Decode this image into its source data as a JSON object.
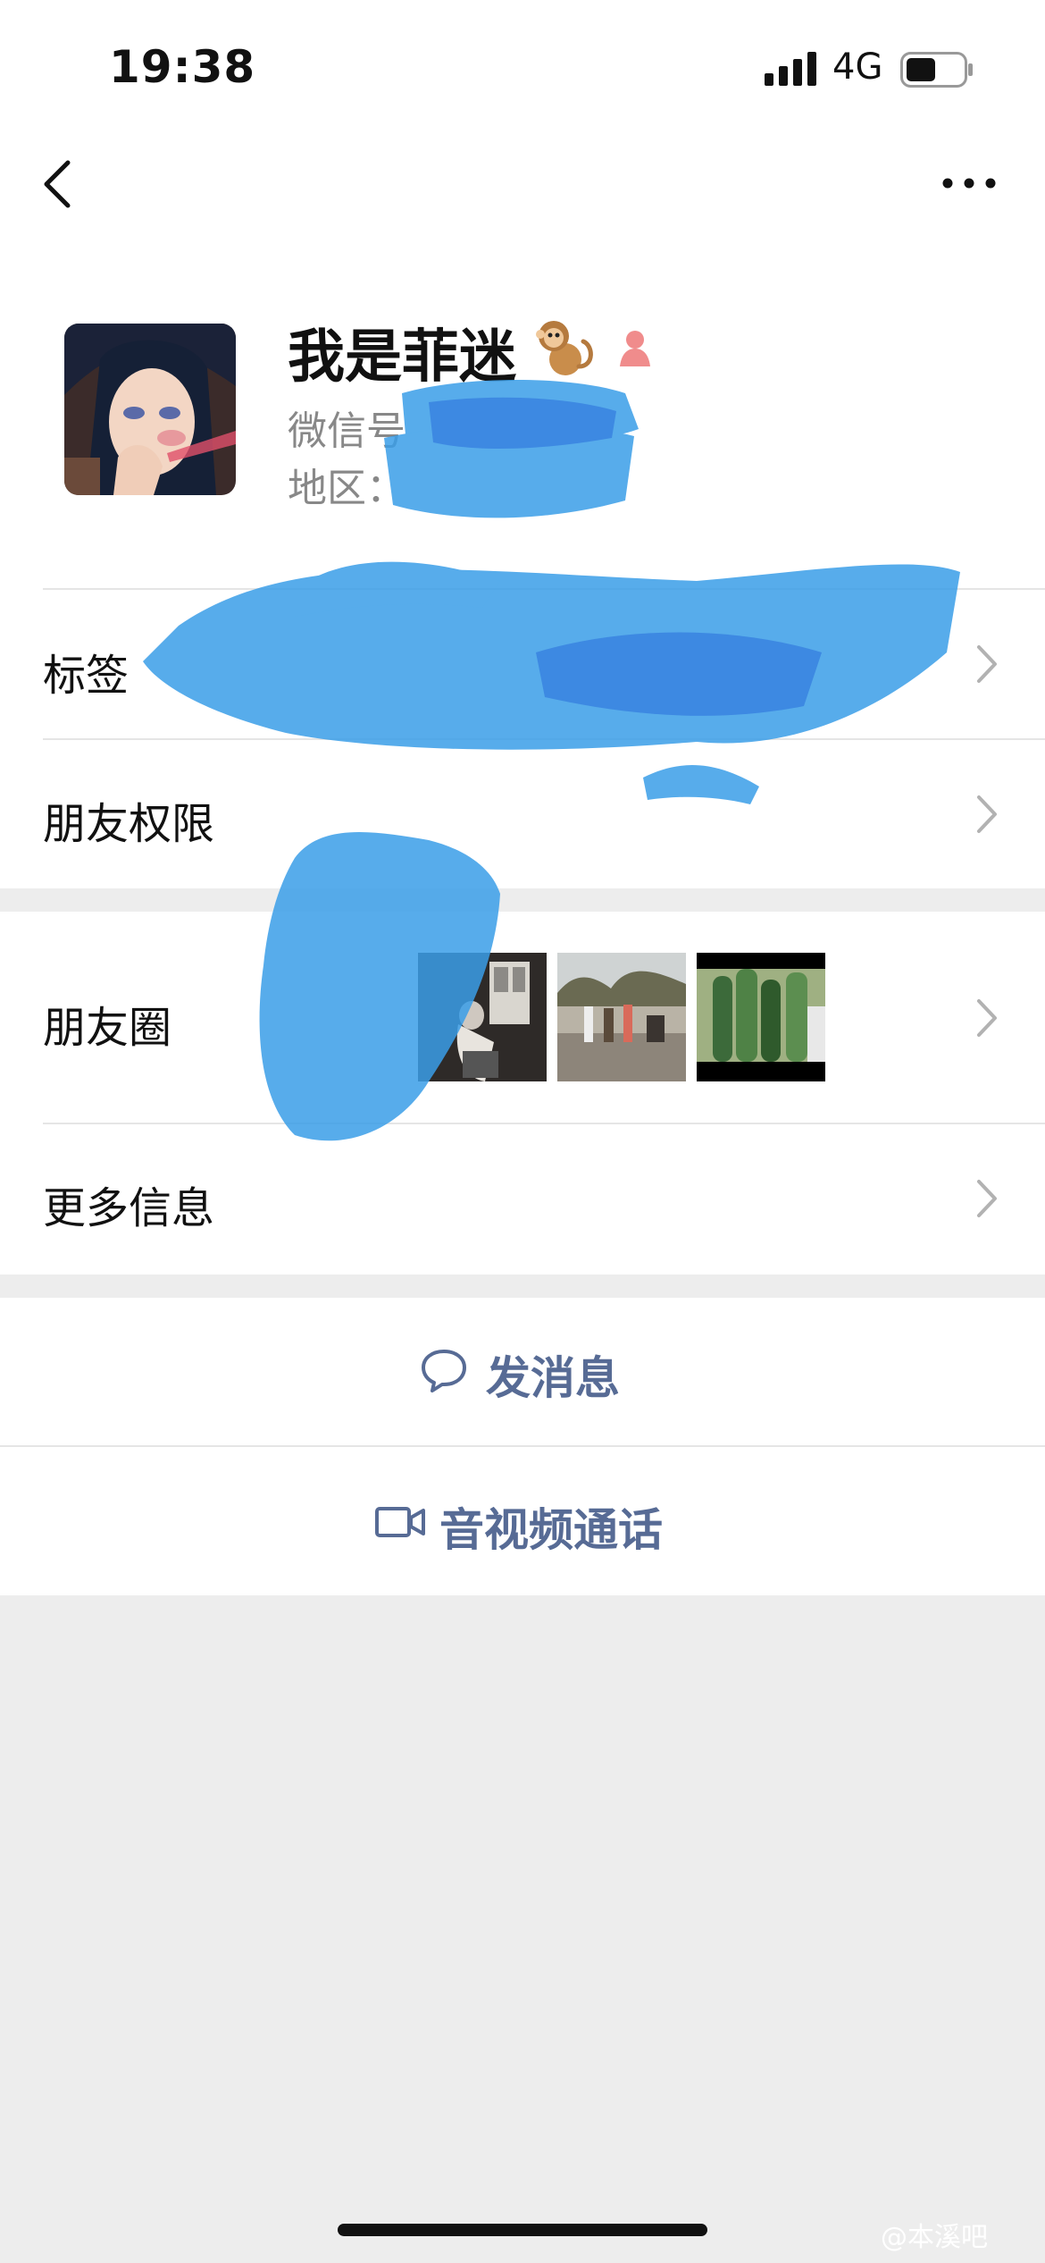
{
  "status_bar": {
    "time": "19:38",
    "network": "4G"
  },
  "nav": {
    "back_icon": "chevron-left-icon",
    "more_icon": "ellipsis-icon"
  },
  "profile": {
    "name": "我是菲迷",
    "name_emoji": "monkey-emoji",
    "gender_icon": "female-person-icon",
    "wechat_id_label": "微信号",
    "region_label": "地区："
  },
  "rows": {
    "tags": "标签",
    "friend_permissions": "朋友权限",
    "moments": "朋友圈",
    "more_info": "更多信息"
  },
  "actions": {
    "send_message": "发消息",
    "av_call": "音视频通话"
  },
  "watermark": "@本溪吧",
  "colors": {
    "link_blue": "#576b95",
    "background": "#ededed",
    "scribble": "#3a9ee8"
  }
}
